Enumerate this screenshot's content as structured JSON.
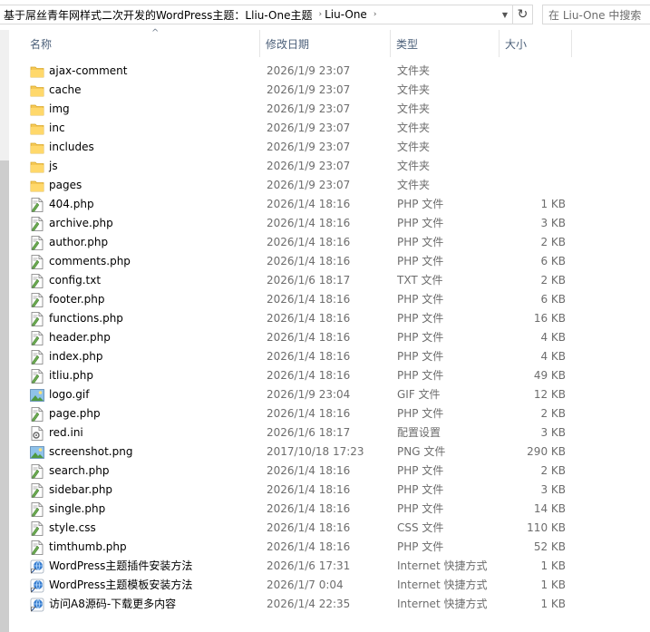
{
  "address": {
    "crumbs": [
      "基于屌丝青年网样式二次开发的WordPress主题：Lliu-One主题",
      "Liu-One"
    ],
    "search_placeholder": "在 Liu-One 中搜索"
  },
  "columns": {
    "name": "名称",
    "date": "修改日期",
    "type": "类型",
    "size": "大小"
  },
  "files": [
    {
      "name": "ajax-comment",
      "date": "2026/1/9 23:07",
      "type": "文件夹",
      "size": "",
      "icon": "folder-icon"
    },
    {
      "name": "cache",
      "date": "2026/1/9 23:07",
      "type": "文件夹",
      "size": "",
      "icon": "folder-icon"
    },
    {
      "name": "img",
      "date": "2026/1/9 23:07",
      "type": "文件夹",
      "size": "",
      "icon": "folder-icon"
    },
    {
      "name": "inc",
      "date": "2026/1/9 23:07",
      "type": "文件夹",
      "size": "",
      "icon": "folder-icon"
    },
    {
      "name": "includes",
      "date": "2026/1/9 23:07",
      "type": "文件夹",
      "size": "",
      "icon": "folder-icon"
    },
    {
      "name": "js",
      "date": "2026/1/9 23:07",
      "type": "文件夹",
      "size": "",
      "icon": "folder-icon"
    },
    {
      "name": "pages",
      "date": "2026/1/9 23:07",
      "type": "文件夹",
      "size": "",
      "icon": "folder-icon"
    },
    {
      "name": "404.php",
      "date": "2026/1/4 18:16",
      "type": "PHP 文件",
      "size": "1 KB",
      "icon": "code-file-icon"
    },
    {
      "name": "archive.php",
      "date": "2026/1/4 18:16",
      "type": "PHP 文件",
      "size": "3 KB",
      "icon": "code-file-icon"
    },
    {
      "name": "author.php",
      "date": "2026/1/4 18:16",
      "type": "PHP 文件",
      "size": "2 KB",
      "icon": "code-file-icon"
    },
    {
      "name": "comments.php",
      "date": "2026/1/4 18:16",
      "type": "PHP 文件",
      "size": "6 KB",
      "icon": "code-file-icon"
    },
    {
      "name": "config.txt",
      "date": "2026/1/6 18:17",
      "type": "TXT 文件",
      "size": "2 KB",
      "icon": "code-file-icon"
    },
    {
      "name": "footer.php",
      "date": "2026/1/4 18:16",
      "type": "PHP 文件",
      "size": "6 KB",
      "icon": "code-file-icon"
    },
    {
      "name": "functions.php",
      "date": "2026/1/4 18:16",
      "type": "PHP 文件",
      "size": "16 KB",
      "icon": "code-file-icon"
    },
    {
      "name": "header.php",
      "date": "2026/1/4 18:16",
      "type": "PHP 文件",
      "size": "4 KB",
      "icon": "code-file-icon"
    },
    {
      "name": "index.php",
      "date": "2026/1/4 18:16",
      "type": "PHP 文件",
      "size": "4 KB",
      "icon": "code-file-icon"
    },
    {
      "name": "itliu.php",
      "date": "2026/1/4 18:16",
      "type": "PHP 文件",
      "size": "49 KB",
      "icon": "code-file-icon"
    },
    {
      "name": "logo.gif",
      "date": "2026/1/9 23:04",
      "type": "GIF 文件",
      "size": "12 KB",
      "icon": "image-file-icon"
    },
    {
      "name": "page.php",
      "date": "2026/1/4 18:16",
      "type": "PHP 文件",
      "size": "2 KB",
      "icon": "code-file-icon"
    },
    {
      "name": "red.ini",
      "date": "2026/1/6 18:17",
      "type": "配置设置",
      "size": "3 KB",
      "icon": "settings-file-icon"
    },
    {
      "name": "screenshot.png",
      "date": "2017/10/18 17:23",
      "type": "PNG 文件",
      "size": "290 KB",
      "icon": "image-file-icon"
    },
    {
      "name": "search.php",
      "date": "2026/1/4 18:16",
      "type": "PHP 文件",
      "size": "2 KB",
      "icon": "code-file-icon"
    },
    {
      "name": "sidebar.php",
      "date": "2026/1/4 18:16",
      "type": "PHP 文件",
      "size": "3 KB",
      "icon": "code-file-icon"
    },
    {
      "name": "single.php",
      "date": "2026/1/4 18:16",
      "type": "PHP 文件",
      "size": "14 KB",
      "icon": "code-file-icon"
    },
    {
      "name": "style.css",
      "date": "2026/1/4 18:16",
      "type": "CSS 文件",
      "size": "110 KB",
      "icon": "code-file-icon"
    },
    {
      "name": "timthumb.php",
      "date": "2026/1/4 18:16",
      "type": "PHP 文件",
      "size": "52 KB",
      "icon": "code-file-icon"
    },
    {
      "name": "WordPress主题插件安装方法",
      "date": "2026/1/6 17:31",
      "type": "Internet 快捷方式",
      "size": "1 KB",
      "icon": "internet-shortcut-icon"
    },
    {
      "name": "WordPress主题模板安装方法",
      "date": "2026/1/7 0:04",
      "type": "Internet 快捷方式",
      "size": "1 KB",
      "icon": "internet-shortcut-icon"
    },
    {
      "name": "访问A8源码-下载更多内容",
      "date": "2026/1/4 22:35",
      "type": "Internet 快捷方式",
      "size": "1 KB",
      "icon": "internet-shortcut-icon"
    }
  ]
}
